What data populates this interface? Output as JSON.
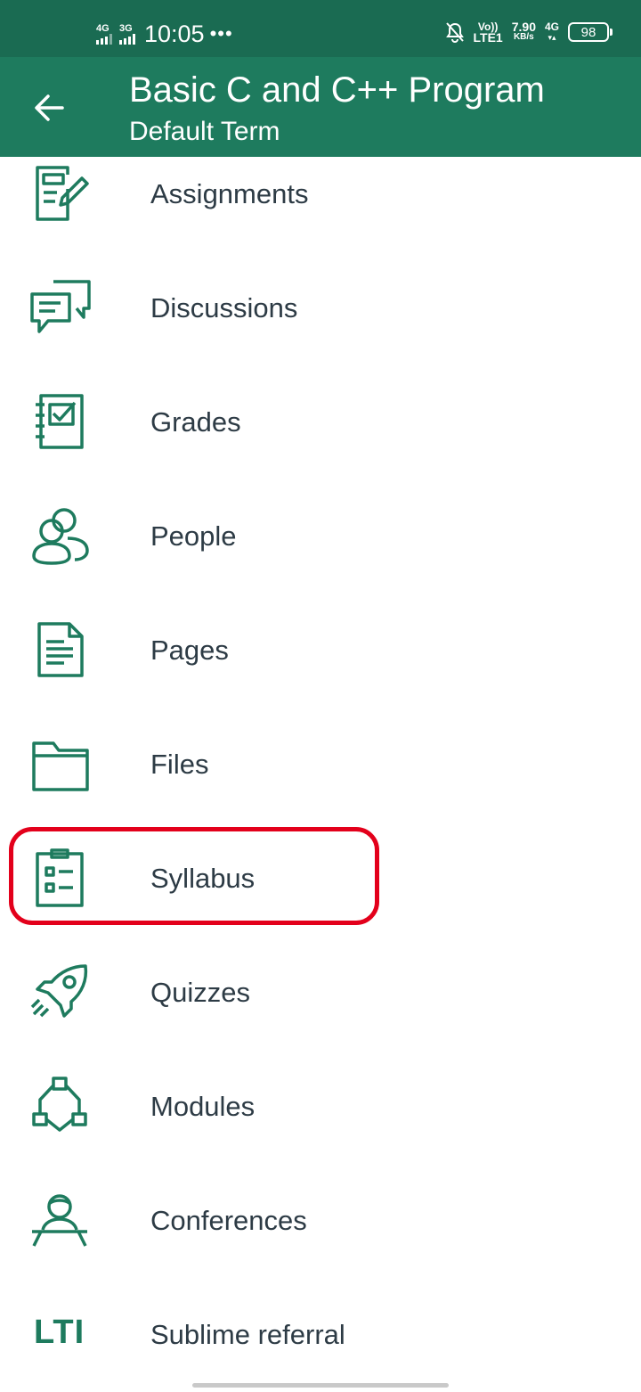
{
  "status_bar": {
    "network_1": "4G",
    "network_2": "3G",
    "time": "10:05",
    "more": "•••",
    "volte_top": "Vo))",
    "volte_bottom": "LTE1",
    "speed_value": "7.90",
    "speed_unit": "KB/s",
    "data_net": "4G",
    "battery": "98"
  },
  "header": {
    "title": "Basic C and C++ Program",
    "subtitle": "Default Term"
  },
  "menu": [
    {
      "label": "Assignments",
      "icon": "assignment-icon"
    },
    {
      "label": "Discussions",
      "icon": "discussion-icon"
    },
    {
      "label": "Grades",
      "icon": "gradebook-icon"
    },
    {
      "label": "People",
      "icon": "people-icon"
    },
    {
      "label": "Pages",
      "icon": "document-icon"
    },
    {
      "label": "Files",
      "icon": "folder-icon"
    },
    {
      "label": "Syllabus",
      "icon": "clipboard-icon"
    },
    {
      "label": "Quizzes",
      "icon": "rocket-icon"
    },
    {
      "label": "Modules",
      "icon": "modules-icon"
    },
    {
      "label": "Conferences",
      "icon": "conference-icon"
    },
    {
      "label": "Sublime referral",
      "icon": "lti-icon",
      "icon_text": "LTI"
    }
  ],
  "highlighted_item": "Syllabus",
  "colors": {
    "status_bar": "#1a6b52",
    "app_bar": "#1e7b5e",
    "icon": "#1e7b5e",
    "text": "#2d3b45",
    "highlight": "#e3001b"
  }
}
